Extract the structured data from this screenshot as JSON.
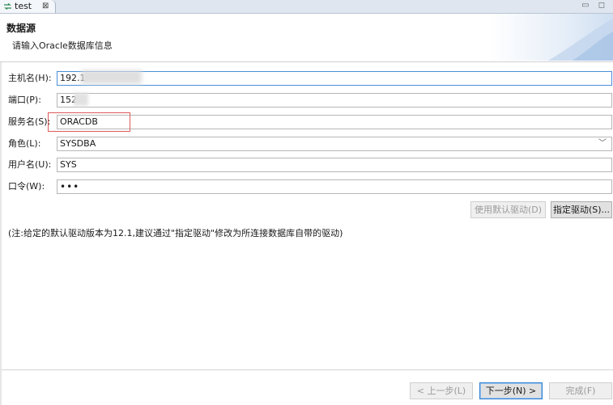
{
  "tab": {
    "title": "test",
    "close": "⊠"
  },
  "window_controls": "▭ ◻",
  "header": {
    "title": "数据源",
    "subtitle": "请输入Oracle数据库信息"
  },
  "form": {
    "host_label": "主机名(H):",
    "host_value": "192.1",
    "port_label": "端口(P):",
    "port_value": "152",
    "service_label": "服务名(S):",
    "service_value": "ORACDB",
    "role_label": "角色(L):",
    "role_value": "SYSDBA",
    "user_label": "用户名(U):",
    "user_value": "SYS",
    "password_label": "口令(W):",
    "password_value": "•••"
  },
  "driver": {
    "default_button": "使用默认驱动(D)",
    "specify_button": "指定驱动(S)..."
  },
  "note": "(注:给定的默认驱动版本为12.1,建议通过\"指定驱动\"修改为所连接数据库自带的驱动)",
  "wizard": {
    "back": "< 上一步(L)",
    "next": "下一步(N) >",
    "finish": "完成(F)"
  },
  "colors": {
    "accent": "#4a8fd6",
    "highlight_box": "#e05a5a",
    "tab_bar": "#dfe6ef"
  }
}
